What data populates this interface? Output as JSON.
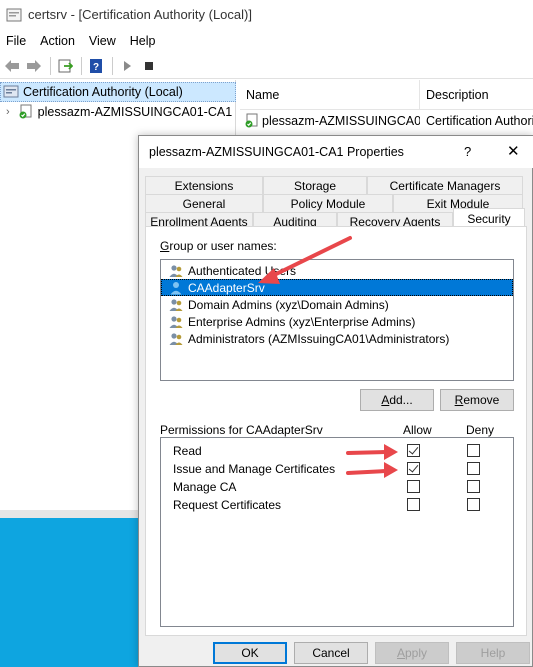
{
  "window": {
    "title": "certsrv - [Certification Authority (Local)]"
  },
  "menu": [
    "File",
    "Action",
    "View",
    "Help"
  ],
  "tree": {
    "root": "Certification Authority (Local)",
    "child": "plessazm-AZMISSUINGCA01-CA1"
  },
  "listview": {
    "col_name": "Name",
    "col_description": "Description",
    "row_name": "plessazm-AZMISSUINGCA0...",
    "row_description": "Certification Authori"
  },
  "dialog": {
    "title": "plessazm-AZMISSUINGCA01-CA1 Properties",
    "help_glyph": "?",
    "close_glyph": "✕",
    "tabs_row1": [
      "Extensions",
      "Storage",
      "Certificate Managers"
    ],
    "tabs_row2": [
      "General",
      "Policy Module",
      "Exit Module"
    ],
    "tabs_row3": [
      "Enrollment Agents",
      "Auditing",
      "Recovery Agents",
      "Security"
    ],
    "group_label": "Group or user names:",
    "users": [
      "Authenticated Users",
      "CAAdapterSrv",
      "Domain Admins (xyz\\Domain Admins)",
      "Enterprise Admins (xyz\\Enterprise Admins)",
      "Administrators (AZMIssuingCA01\\Administrators)"
    ],
    "selected_user_index": 1,
    "add_button": "Add...",
    "remove_button": "Remove",
    "perm_header": "Permissions for CAAdapterSrv",
    "allow_header": "Allow",
    "deny_header": "Deny",
    "permissions": [
      {
        "name": "Read",
        "allow": true,
        "deny": false
      },
      {
        "name": "Issue and Manage Certificates",
        "allow": true,
        "deny": false
      },
      {
        "name": "Manage CA",
        "allow": false,
        "deny": false
      },
      {
        "name": "Request Certificates",
        "allow": false,
        "deny": false
      }
    ],
    "ok_button": "OK",
    "cancel_button": "Cancel",
    "apply_button": "Apply",
    "help_button": "Help"
  },
  "colors": {
    "accent": "#0078d7",
    "annotation_arrow": "#e8474b",
    "desktop": "#0ea5e0"
  }
}
